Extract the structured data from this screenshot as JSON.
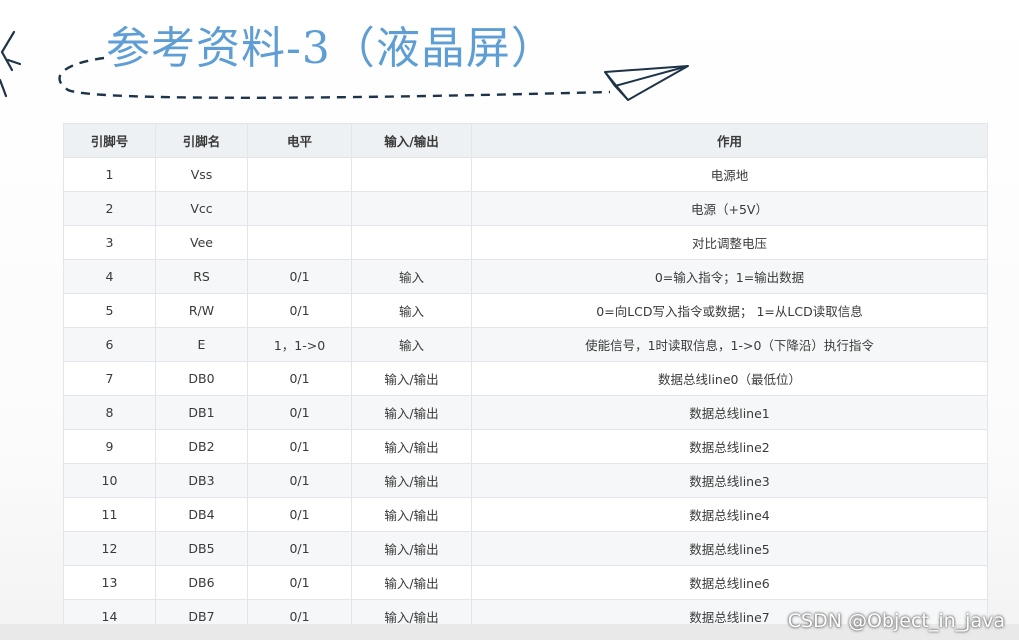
{
  "title": "参考资料-3（液晶屏）",
  "table": {
    "headers": [
      "引脚号",
      "引脚名",
      "电平",
      "输入/输出",
      "作用"
    ],
    "rows": [
      [
        "1",
        "Vss",
        "",
        "",
        "电源地"
      ],
      [
        "2",
        "Vcc",
        "",
        "",
        "电源（+5V）"
      ],
      [
        "3",
        "Vee",
        "",
        "",
        "对比调整电压"
      ],
      [
        "4",
        "RS",
        "0/1",
        "输入",
        "0=输入指令；1=输出数据"
      ],
      [
        "5",
        "R/W",
        "0/1",
        "输入",
        "0=向LCD写入指令或数据； 1=从LCD读取信息"
      ],
      [
        "6",
        "E",
        "1，1->0",
        "输入",
        "使能信号，1时读取信息，1->0（下降沿）执行指令"
      ],
      [
        "7",
        "DB0",
        "0/1",
        "输入/输出",
        "数据总线line0（最低位）"
      ],
      [
        "8",
        "DB1",
        "0/1",
        "输入/输出",
        "数据总线line1"
      ],
      [
        "9",
        "DB2",
        "0/1",
        "输入/输出",
        "数据总线line2"
      ],
      [
        "10",
        "DB3",
        "0/1",
        "输入/输出",
        "数据总线line3"
      ],
      [
        "11",
        "DB4",
        "0/1",
        "输入/输出",
        "数据总线line4"
      ],
      [
        "12",
        "DB5",
        "0/1",
        "输入/输出",
        "数据总线line5"
      ],
      [
        "13",
        "DB6",
        "0/1",
        "输入/输出",
        "数据总线line6"
      ],
      [
        "14",
        "DB7",
        "0/1",
        "输入/输出",
        "数据总线line7"
      ]
    ]
  },
  "watermark": "CSDN @Object_in_java",
  "colors": {
    "title": "#5e9ed4",
    "decoration": "#1f3348",
    "header_bg": "#eef1f4",
    "row_alt_bg": "#f6f7f8",
    "border": "#e2e5e9"
  },
  "icons": [
    "chevron-left-icon",
    "paper-plane-icon"
  ]
}
